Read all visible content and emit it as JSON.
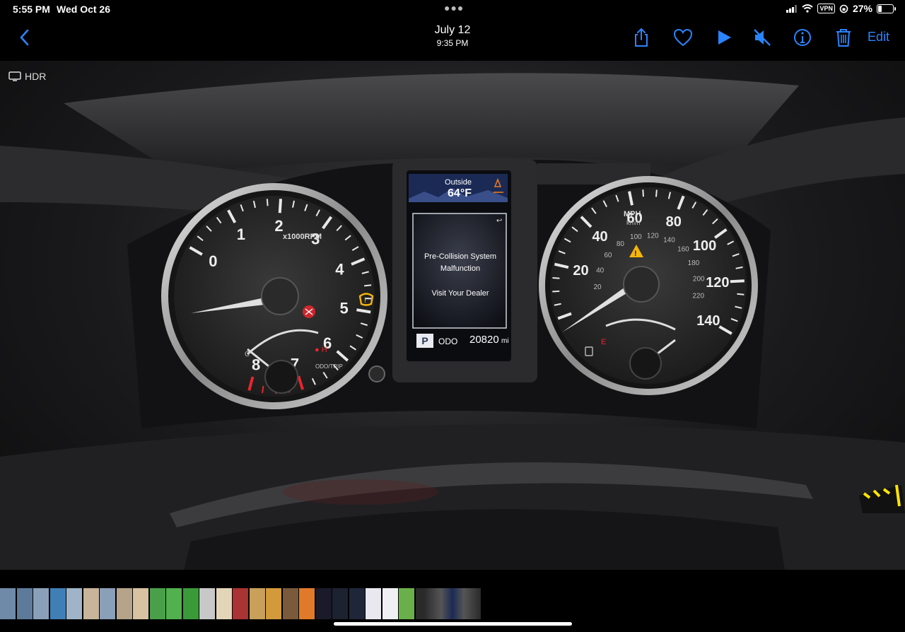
{
  "status": {
    "time": "5:55 PM",
    "date": "Wed Oct 26",
    "vpn": "VPN",
    "battery": "27%",
    "battery_level": 0.27
  },
  "nav": {
    "title": "July 12",
    "subtitle": "9:35 PM",
    "edit": "Edit"
  },
  "photo": {
    "badge": "HDR",
    "tach_unit": "x1000RPM",
    "tach_numbers": [
      "0",
      "1",
      "2",
      "3",
      "4",
      "5",
      "6",
      "7",
      "8"
    ],
    "odo_trip": "ODO/TRIP",
    "outside_label": "Outside",
    "outside_temp": "64°F",
    "message_line1": "Pre-Collision System",
    "message_line2": "Malfunction",
    "message_line3": "Visit Your Dealer",
    "gear": "P",
    "odo_label": "ODO",
    "odo_value": "20820",
    "odo_unit": "mi",
    "mph_label": "MPH",
    "kmh_label": "km/h",
    "mph_numbers": [
      "20",
      "40",
      "60",
      "80",
      "100",
      "120",
      "140"
    ],
    "kmh_numbers": [
      "20",
      "40",
      "60",
      "80",
      "100",
      "120",
      "140",
      "160",
      "180",
      "200",
      "220"
    ]
  },
  "colors": {
    "accent": "#2a84ff",
    "warning": "#f5b50a",
    "alert_red": "#e8262e"
  }
}
